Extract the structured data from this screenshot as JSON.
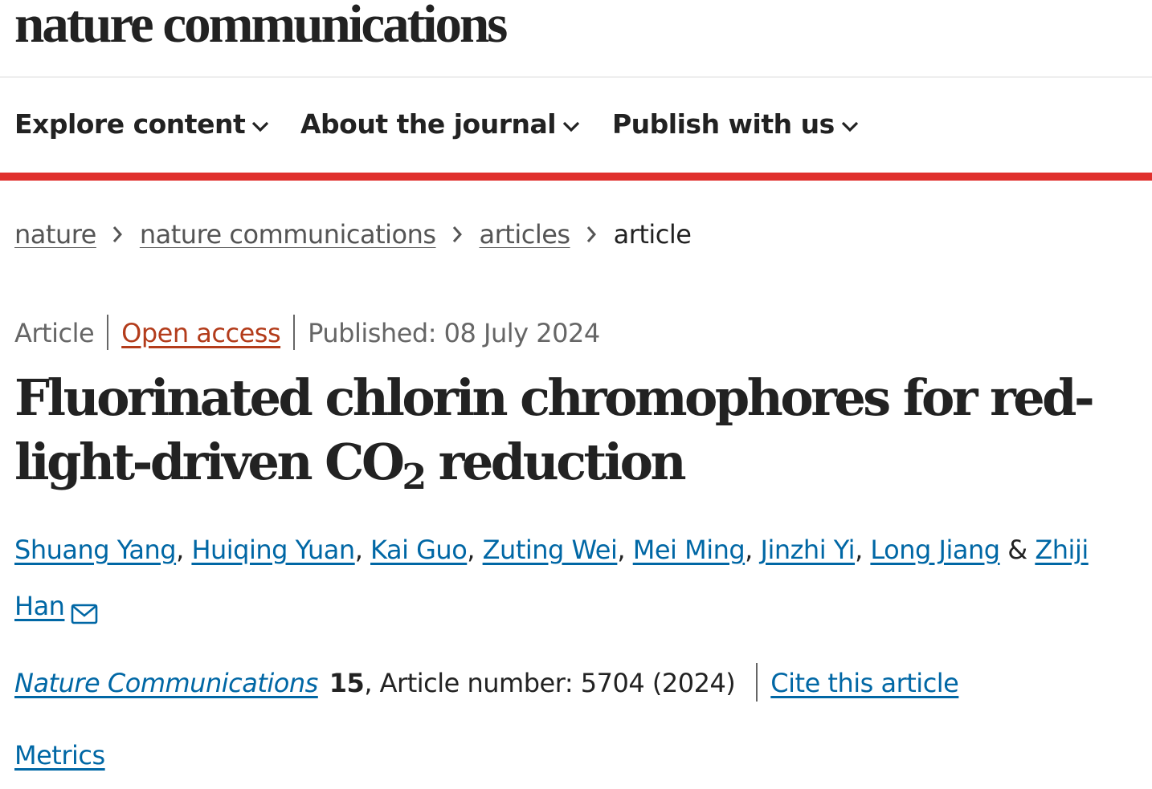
{
  "header": {
    "logo_text": "nature communications"
  },
  "nav": {
    "items": [
      {
        "label": "Explore content",
        "icon": "chevron-down-icon"
      },
      {
        "label": "About the journal",
        "icon": "chevron-down-icon"
      },
      {
        "label": "Publish with us",
        "icon": "chevron-down-icon"
      }
    ]
  },
  "colors": {
    "accent_rule": "#e0302d",
    "link": "#0067a5",
    "open_access": "#b33c1b"
  },
  "breadcrumb": {
    "items": [
      "nature",
      "nature communications",
      "articles"
    ],
    "current": "article",
    "separator_icon": "chevron-right-icon"
  },
  "article": {
    "type": "Article",
    "access": "Open access",
    "published": "Published: 08 July 2024",
    "title_part1": "Fluorinated chlorin chromophores for red-light-driven CO",
    "title_sub": "2",
    "title_part2": " reduction",
    "authors": [
      "Shuang Yang",
      "Huiqing Yuan",
      "Kai Guo",
      "Zuting Wei",
      "Mei Ming",
      "Jinzhi Yi",
      "Long Jiang",
      "Zhiji Han"
    ],
    "author_separator": ", ",
    "author_last_separator": " & ",
    "corresponding_icon": "mail-icon",
    "journal": "Nature Communications",
    "volume": "15",
    "article_number": ", Article number: 5704 (2024)",
    "cite_label": "Cite this article",
    "metrics_label": "Metrics"
  }
}
